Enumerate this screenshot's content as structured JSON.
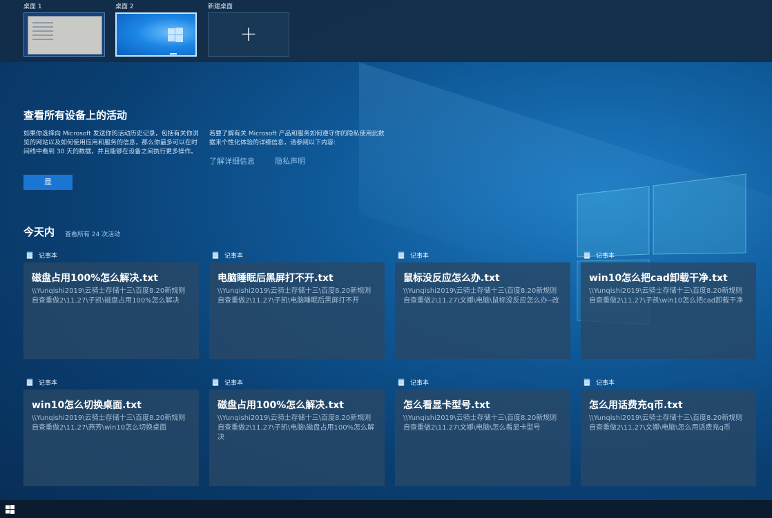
{
  "desktops": [
    {
      "label": "桌面 1"
    },
    {
      "label": "桌面 2"
    },
    {
      "label": "新建桌面",
      "icon": "plus-icon"
    }
  ],
  "activity_prompt": {
    "title": "查看所有设备上的活动",
    "description_left": "如果你选择向 Microsoft 发送你的活动历史记录，包括有关你浏览的网站以及如何使用应用和服务的信息，那么你最多可以在时间线中看到 30 天的数据，并且能够在设备之间执行更多操作。",
    "description_right": "若要了解有关 Microsoft 产品和服务如何遵守你的隐私使用此数据来个性化体验的详细信息，请参阅以下内容:",
    "learn_more": "了解详细信息",
    "privacy": "隐私声明",
    "yes_button": "是"
  },
  "timeline": {
    "heading": "今天内",
    "see_all": "查看所有 24 次活动",
    "cards": [
      {
        "app": "记事本",
        "title": "磁盘占用100%怎么解决.txt",
        "path": "\\\\Yunqishi2019\\云骑士存储十三\\百度8.20新规则自查重做2\\11.27\\子凯\\磁盘占用100%怎么解决"
      },
      {
        "app": "记事本",
        "title": "电脑睡眠后黑屏打不开.txt",
        "path": "\\\\Yunqishi2019\\云骑士存储十三\\百度8.20新规则自查重做2\\11.27\\子凯\\电脑睡眠后黑屏打不开"
      },
      {
        "app": "记事本",
        "title": "鼠标没反应怎么办.txt",
        "path": "\\\\Yunqishi2019\\云骑士存储十三\\百度8.20新规则自查重做2\\11.27\\文娜\\电脑\\鼠标没反应怎么办--改"
      },
      {
        "app": "记事本",
        "title": "win10怎么把cad卸载干净.txt",
        "path": "\\\\Yunqishi2019\\云骑士存储十三\\百度8.20新规则自查重做2\\11.27\\子凯\\win10怎么把cad卸载干净"
      },
      {
        "app": "记事本",
        "title": "win10怎么切换桌面.txt",
        "path": "\\\\Yunqishi2019\\云骑士存储十三\\百度8.20新规则自查重做2\\11.27\\燕芳\\win10怎么切换桌面"
      },
      {
        "app": "记事本",
        "title": "磁盘占用100%怎么解决.txt",
        "path": "\\\\Yunqishi2019\\云骑士存储十三\\百度8.20新规则自查重做2\\11.27\\子凯\\电脑\\磁盘占用100%怎么解决"
      },
      {
        "app": "记事本",
        "title": "怎么看显卡型号.txt",
        "path": "\\\\Yunqishi2019\\云骑士存储十三\\百度8.20新规则自查重做2\\11.27\\文娜\\电脑\\怎么看显卡型号"
      },
      {
        "app": "记事本",
        "title": "怎么用话费充q币.txt",
        "path": "\\\\Yunqishi2019\\云骑士存储十三\\百度8.20新规则自查重做2\\11.27\\文娜\\电脑\\怎么用话费充q币"
      }
    ]
  },
  "colors": {
    "accent": "#1a75d4",
    "link": "#8fc3ec",
    "card_bg": "#284866",
    "desktop_strip": "#142c46"
  }
}
